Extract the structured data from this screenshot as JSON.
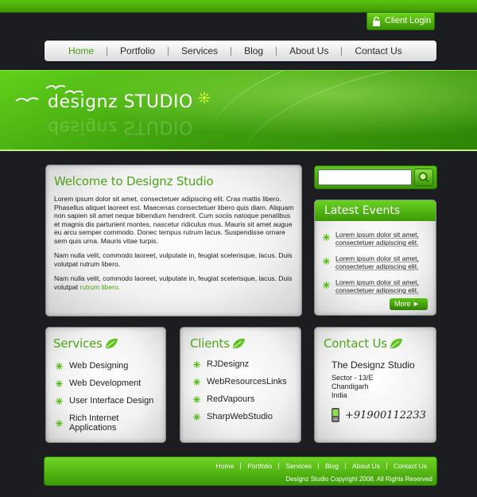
{
  "header": {
    "client_login": "Client Login"
  },
  "nav": {
    "items": [
      {
        "label": "Home",
        "active": true
      },
      {
        "label": "Portfolio"
      },
      {
        "label": "Services"
      },
      {
        "label": "Blog"
      },
      {
        "label": "About Us"
      },
      {
        "label": "Contact Us"
      }
    ]
  },
  "banner": {
    "logo_text": "designz STUDIO"
  },
  "welcome": {
    "title": "Welcome to Designz Studio",
    "paragraph1": "Lorem ipsum dolor sit amet, consectetuer adipiscing elit. Cras mattis libero. Phasellus aliquet laoreet est. Maecenas consectetuer libero quis diam. Aliquam non sapien sit amet neque bibendum hendrerit. Cum sociis natoque penatibus et magnis dis parturient montes, nascetur ridiculus mus. Mauris sit amet augue eu arcu semper commodo. Donec tempus rutrum lacus. Suspendisse ornare sem quis urna. Mauris vitae turpis.",
    "paragraph2": "Nam nulla velit, commodo laoreet, vulputate in, feugiat scelerisque, lacus. Duis volutpat rutrum libero.",
    "paragraph3_text": "Nam nulla velit, commodo laoreet, vulputate in, feugiat scelerisque, lacus. Duis volutpat ",
    "paragraph3_link": "rutrum libero",
    "paragraph3_end": "."
  },
  "search": {
    "placeholder": "",
    "value": ""
  },
  "events": {
    "title": "Latest Events",
    "items": [
      "Lorem ipsum dolor sit amet, consectetuer adipiscing elit.",
      "Lorem ipsum dolor sit amet, consectetuer adipiscing elit.",
      "Lorem ipsum dolor sit amet, consectetuer adipiscing elit."
    ],
    "more_label": "More"
  },
  "services": {
    "title": "Services",
    "items": [
      "Web Designing",
      "Web Development",
      "User Interface Design",
      "Rich Internet Applications"
    ]
  },
  "clients": {
    "title": "Clients",
    "items": [
      "RJDesignz",
      "WebResourcesLinks",
      "RedVapours",
      "SharpWebStudio"
    ]
  },
  "contact": {
    "title": "Contact Us",
    "name": "The Designz Studio",
    "line1": "Sector - 13/E",
    "line2": "Chandigarh",
    "line3": "India",
    "phone": "+91900112233"
  },
  "footer": {
    "links": [
      "Home",
      "Portfolio",
      "Services",
      "Blog",
      "About Us",
      "Contact Us"
    ],
    "copyright": "Designz Studio Copyright 2008. All Rights Reserved"
  },
  "colors": {
    "accent": "#4ea418",
    "background": "#1b1d20",
    "banner": "#4cb413"
  }
}
